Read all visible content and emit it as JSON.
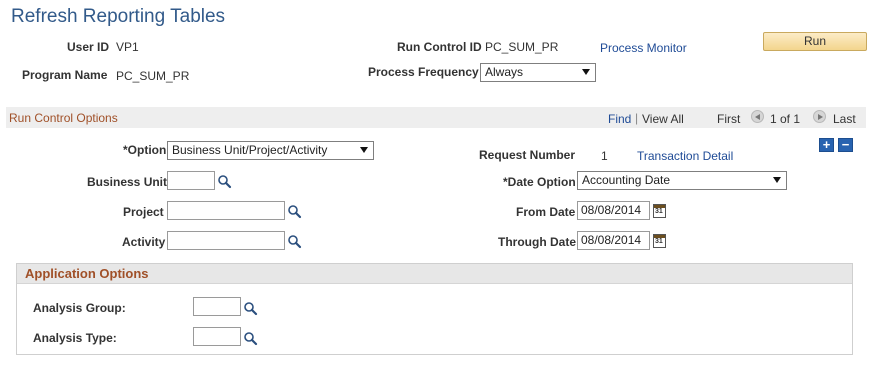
{
  "page": {
    "title": "Refresh Reporting Tables"
  },
  "header": {
    "user_id_label": "User ID",
    "user_id_value": "VP1",
    "program_name_label": "Program Name",
    "program_name_value": "PC_SUM_PR",
    "run_control_id_label": "Run Control ID",
    "run_control_id_value": "PC_SUM_PR",
    "process_monitor_link": "Process Monitor",
    "process_frequency_label": "Process Frequency",
    "process_frequency_value": "Always",
    "run_button": "Run"
  },
  "run_control_options": {
    "title": "Run Control Options",
    "nav": {
      "find": "Find",
      "separator": "|",
      "view_all": "View All",
      "first": "First",
      "range": "1 of 1",
      "last": "Last"
    },
    "option_label": "*Option",
    "option_value": "Business Unit/Project/Activity",
    "request_number_label": "Request Number",
    "request_number_value": "1",
    "transaction_detail_link": "Transaction Detail",
    "business_unit_label": "Business Unit",
    "business_unit_value": "",
    "date_option_label": "*Date Option",
    "date_option_value": "Accounting Date",
    "project_label": "Project",
    "project_value": "",
    "from_date_label": "From Date",
    "from_date_value": "08/08/2014",
    "activity_label": "Activity",
    "activity_value": "",
    "through_date_label": "Through Date",
    "through_date_value": "08/08/2014",
    "add_row": "+",
    "delete_row": "−"
  },
  "application_options": {
    "title": "Application Options",
    "analysis_group_label": "Analysis Group:",
    "analysis_group_value": "",
    "analysis_type_label": "Analysis Type:",
    "analysis_type_value": ""
  },
  "icons": {
    "lookup": "magnifier-icon",
    "calendar": "calendar-icon",
    "calendar_day": "31",
    "nav_prev": "left-arrow-icon",
    "nav_next": "right-arrow-icon"
  },
  "colors": {
    "title": "#325a8a",
    "link": "#1f4b96",
    "section_title": "#a05028",
    "button_bg": "#f3d58d",
    "add_delete_bg": "#2863b0"
  }
}
